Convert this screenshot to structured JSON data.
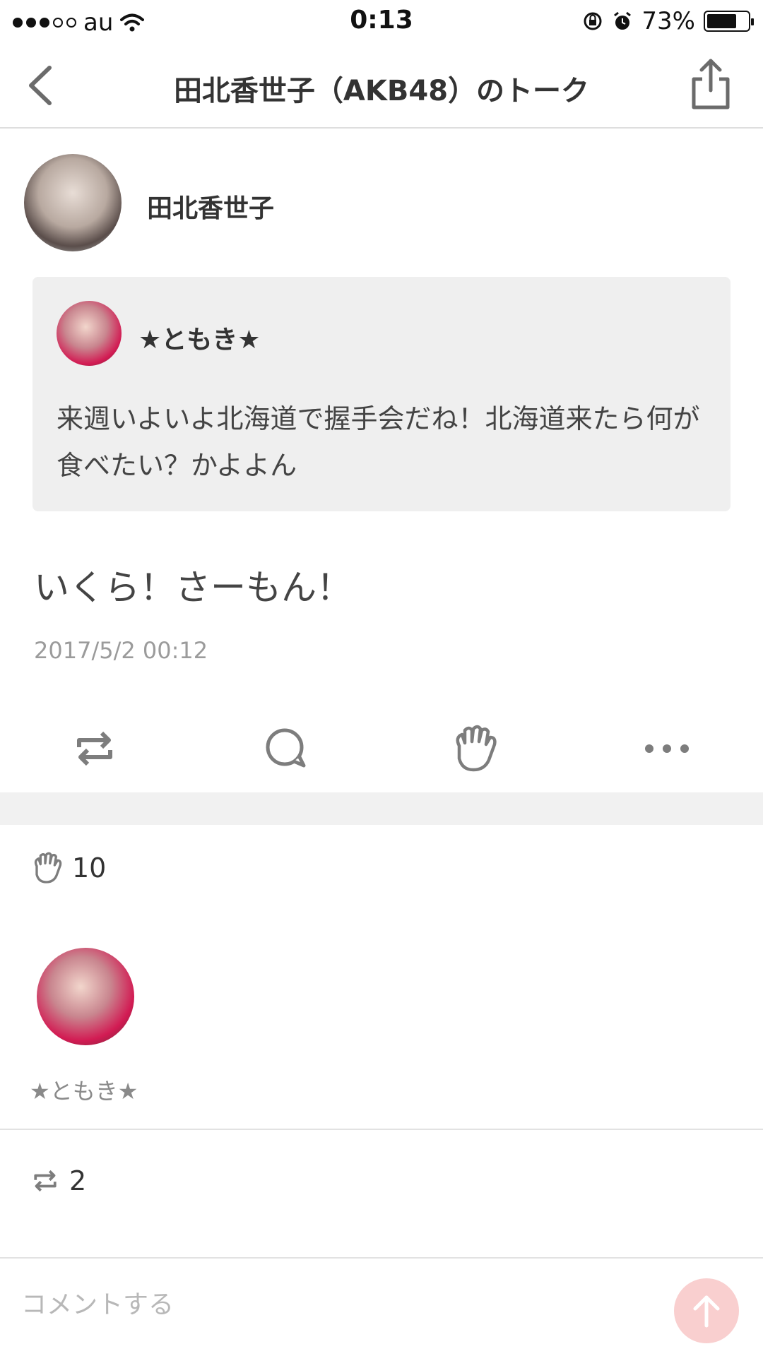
{
  "status_bar": {
    "carrier": "au",
    "time": "0:13",
    "battery": "73%",
    "battery_level": 0.73
  },
  "nav": {
    "title": "田北香世子（AKB48）のトーク"
  },
  "post": {
    "author_name": "田北香世子",
    "quote": {
      "name": "★ともき★",
      "text": "来週いよいよ北海道で握手会だね！北海道来たら何が食べたい？かよよん"
    },
    "reply": "いくら！さーもん！",
    "timestamp": "2017/5/2 00:12"
  },
  "likes": {
    "count": "10",
    "users": [
      {
        "name": "★ともき★"
      }
    ]
  },
  "reposts": {
    "count": "2"
  },
  "comment": {
    "placeholder": "コメントする"
  },
  "colors": {
    "accent": "#f9cfcf",
    "icon_gray": "#7d7d7d",
    "divider": "#f1f1f1"
  },
  "icons": {
    "back": "chevron-left-icon",
    "share": "share-icon",
    "repost": "repost-icon",
    "comment": "comment-icon",
    "handshake": "handshake-icon",
    "more": "more-icon",
    "send": "arrow-up-icon"
  }
}
